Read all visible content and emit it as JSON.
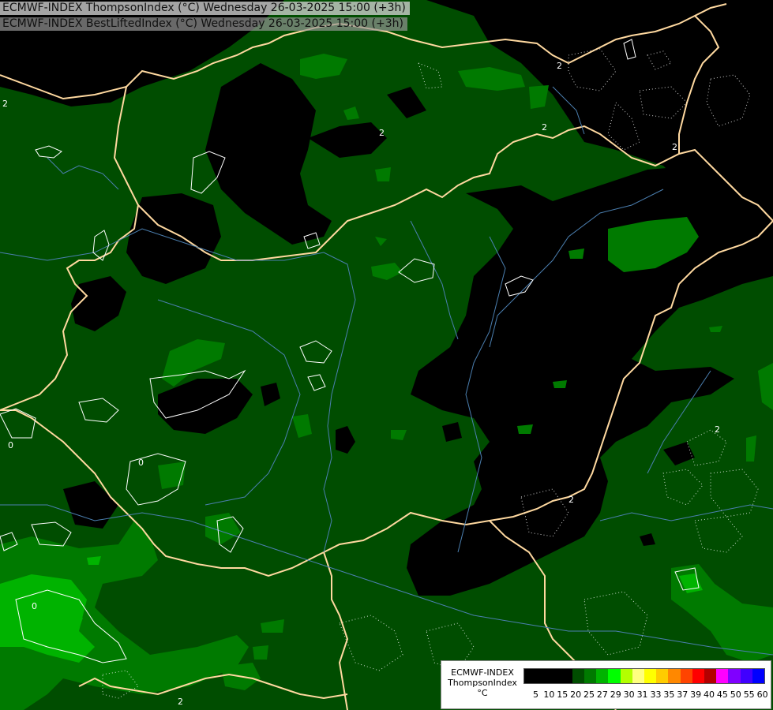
{
  "titles": {
    "line1": "ECMWF-INDEX ThompsonIndex (°C) Wednesday 26-03-2025 15:00 (+3h)",
    "line2": "ECMWF-INDEX BestLiftedIndex (°C) Wednesday 26-03-2025 15:00 (+3h)"
  },
  "legend": {
    "model": "ECMWF-INDEX",
    "parameter": "ThompsonIndex",
    "unit": "°C",
    "ticks": [
      "5",
      "10",
      "15",
      "20",
      "25",
      "27",
      "29",
      "30",
      "31",
      "33",
      "35",
      "37",
      "39",
      "40",
      "45",
      "50",
      "55",
      "60"
    ],
    "colors": [
      "#000000",
      "#000000",
      "#000000",
      "#000000",
      "#004d00",
      "#007a00",
      "#00b300",
      "#00ff00",
      "#b3ff00",
      "#ffff80",
      "#ffff00",
      "#ffcc00",
      "#ff8800",
      "#ff4400",
      "#ff0000",
      "#b30000",
      "#ff00ff",
      "#8000ff",
      "#4000ff",
      "#0000ff"
    ]
  },
  "contour_labels": [
    "2",
    "2",
    "2",
    "2",
    "2",
    "2",
    "0",
    "0",
    "0",
    "2",
    "2"
  ],
  "colors": {
    "background_green": "#004d00",
    "mid_green": "#007a00",
    "light_green": "#00b300",
    "dark": "#000000",
    "border": "#ffd9a0",
    "river": "#4b7fb0"
  }
}
